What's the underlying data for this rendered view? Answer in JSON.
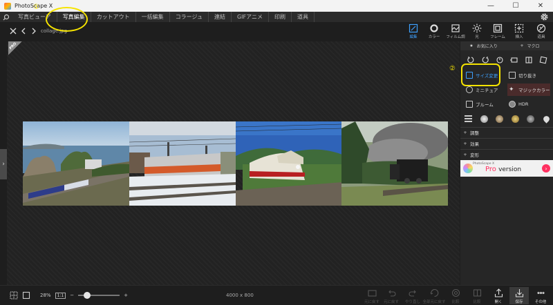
{
  "window": {
    "title": "PhotoScape X",
    "minimize": "—",
    "maximize": "☐",
    "close": "✕"
  },
  "menu": {
    "tabs": [
      "写真ビューア",
      "写真編集",
      "カットアウト",
      "一括編集",
      "コラージュ",
      "連結",
      "GIFアニメ",
      "印刷",
      "道具"
    ],
    "active": "写真編集"
  },
  "toolbar": {
    "filename": "collage.jpg",
    "tools": [
      {
        "label": "編集",
        "icon": "edit-icon",
        "active": true
      },
      {
        "label": "カラー",
        "icon": "color-icon"
      },
      {
        "label": "フィルム調",
        "icon": "film-icon"
      },
      {
        "label": "光",
        "icon": "light-icon"
      },
      {
        "label": "フレーム",
        "icon": "frame-icon"
      },
      {
        "label": "挿入",
        "icon": "insert-icon"
      },
      {
        "label": "道具",
        "icon": "tools-icon"
      }
    ]
  },
  "canvas": {
    "badge": "PRO"
  },
  "panel": {
    "favorites": "お気に入り",
    "macro": "マクロ",
    "features": {
      "resize": "サイズ変更",
      "crop": "切り抜き",
      "miniature": "ミニチュア",
      "magic_color": "マジックカラー",
      "bloom": "ブルーム",
      "hdr": "HDR"
    },
    "sections": [
      "調整",
      "効果",
      "変形"
    ],
    "banner": {
      "brand": "PhotoScape X",
      "pro": "Pro",
      "version": "version"
    }
  },
  "bottom": {
    "zoom": "28%",
    "one_to_one": "1:1",
    "dimensions": "4000 x 800",
    "actions": [
      {
        "label": "元に戻す",
        "icon": "undo-all-icon",
        "enabled": false
      },
      {
        "label": "元に戻す",
        "icon": "undo-icon",
        "enabled": false
      },
      {
        "label": "やり直し",
        "icon": "redo-icon",
        "enabled": false
      },
      {
        "label": "全部元に戻す",
        "icon": "revert-icon",
        "enabled": false
      },
      {
        "label": "比較",
        "icon": "compare-icon",
        "enabled": false
      },
      {
        "label": "比較",
        "icon": "compare2-icon",
        "enabled": false
      },
      {
        "label": "開く",
        "icon": "open-icon",
        "enabled": true
      },
      {
        "label": "保存",
        "icon": "save-icon",
        "enabled": true
      },
      {
        "label": "その他",
        "icon": "more-icon",
        "enabled": true
      }
    ]
  },
  "annotations": {
    "step1": "①",
    "step2": "②"
  },
  "colors": {
    "accent": "#3ea1ff",
    "highlight": "#f6e400",
    "pro": "#ff3060"
  }
}
